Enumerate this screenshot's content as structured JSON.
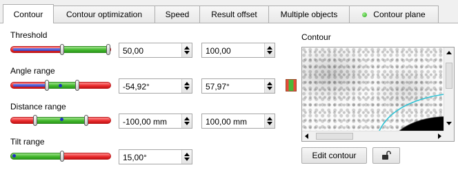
{
  "tabs": [
    {
      "label": "Contour",
      "active": true
    },
    {
      "label": "Contour optimization",
      "active": false
    },
    {
      "label": "Speed",
      "active": false
    },
    {
      "label": "Result offset",
      "active": false
    },
    {
      "label": "Multiple objects",
      "active": false
    },
    {
      "label": "Contour plane",
      "active": false,
      "indicator": "green-dot-icon",
      "indicator_color": "#3cc229"
    }
  ],
  "threshold": {
    "label": "Threshold",
    "min": "50,00",
    "max": "100,00"
  },
  "angle_range": {
    "label": "Angle range",
    "min": "-54,92°",
    "max": "57,97°"
  },
  "distance_range": {
    "label": "Distance range",
    "min": "-100,00 mm",
    "max": "100,00 mm"
  },
  "tilt_range": {
    "label": "Tilt range",
    "value": "15,00°"
  },
  "preview": {
    "label": "Contour"
  },
  "buttons": {
    "edit_contour": "Edit contour",
    "lock": "unlock-icon"
  },
  "colors": {
    "slider_red": "#e8282a",
    "slider_green": "#3fb52a",
    "slider_blue": "#2c3fc7",
    "contour_edge": "#2ec4d6"
  }
}
